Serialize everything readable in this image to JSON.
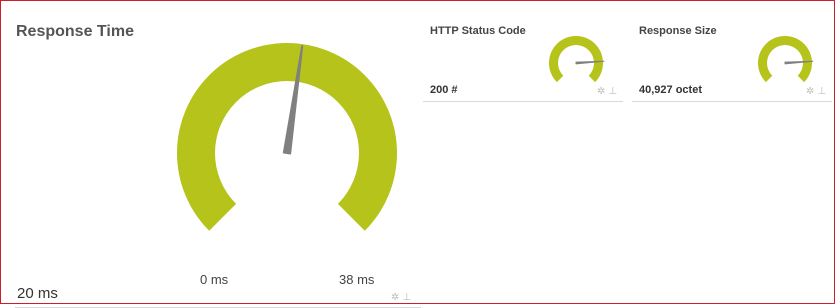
{
  "colors": {
    "gauge_fill": "#b5c31a",
    "needle": "#808080",
    "border": "#cc1f2d"
  },
  "response_time": {
    "title": "Response Time",
    "value_label": "20 ms",
    "min_label": "0 ms",
    "max_label": "38 ms",
    "gauge_level": 0.53
  },
  "http_status": {
    "title": "HTTP Status Code",
    "value_label": "200 #",
    "gauge_level": 0.82
  },
  "response_size": {
    "title": "Response Size",
    "value_label": "40,927 octet",
    "gauge_level": 0.82
  },
  "icons": {
    "settings": "gear-icon",
    "pin": "pin-icon"
  }
}
